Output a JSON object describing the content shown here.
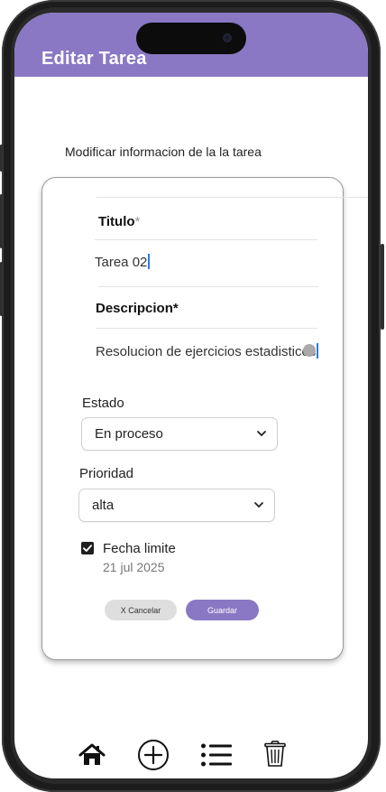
{
  "header": {
    "title": "Editar Tarea"
  },
  "page": {
    "subtitle": "Modificar informacion de la la tarea"
  },
  "form": {
    "title_label": "Titulo",
    "title_req": "*",
    "title_value": "Tarea  02",
    "description_label": "Descripcion*",
    "description_value": "Resolucion de ejercicios estadisticos",
    "status_label": "Estado",
    "status_value": "En proceso",
    "priority_label": "Prioridad",
    "priority_value": "alta",
    "deadline_label": "Fecha limite",
    "deadline_checked": true,
    "deadline_value": "21 jul 2025"
  },
  "actions": {
    "cancel_label": "X Cancelar",
    "save_label": "Guardar"
  },
  "bottom_nav": {
    "icons": [
      "home-icon",
      "add-circle-icon",
      "list-icon",
      "trash-icon"
    ]
  },
  "colors": {
    "accent": "#8a78c4",
    "caret": "#2a7be0"
  }
}
